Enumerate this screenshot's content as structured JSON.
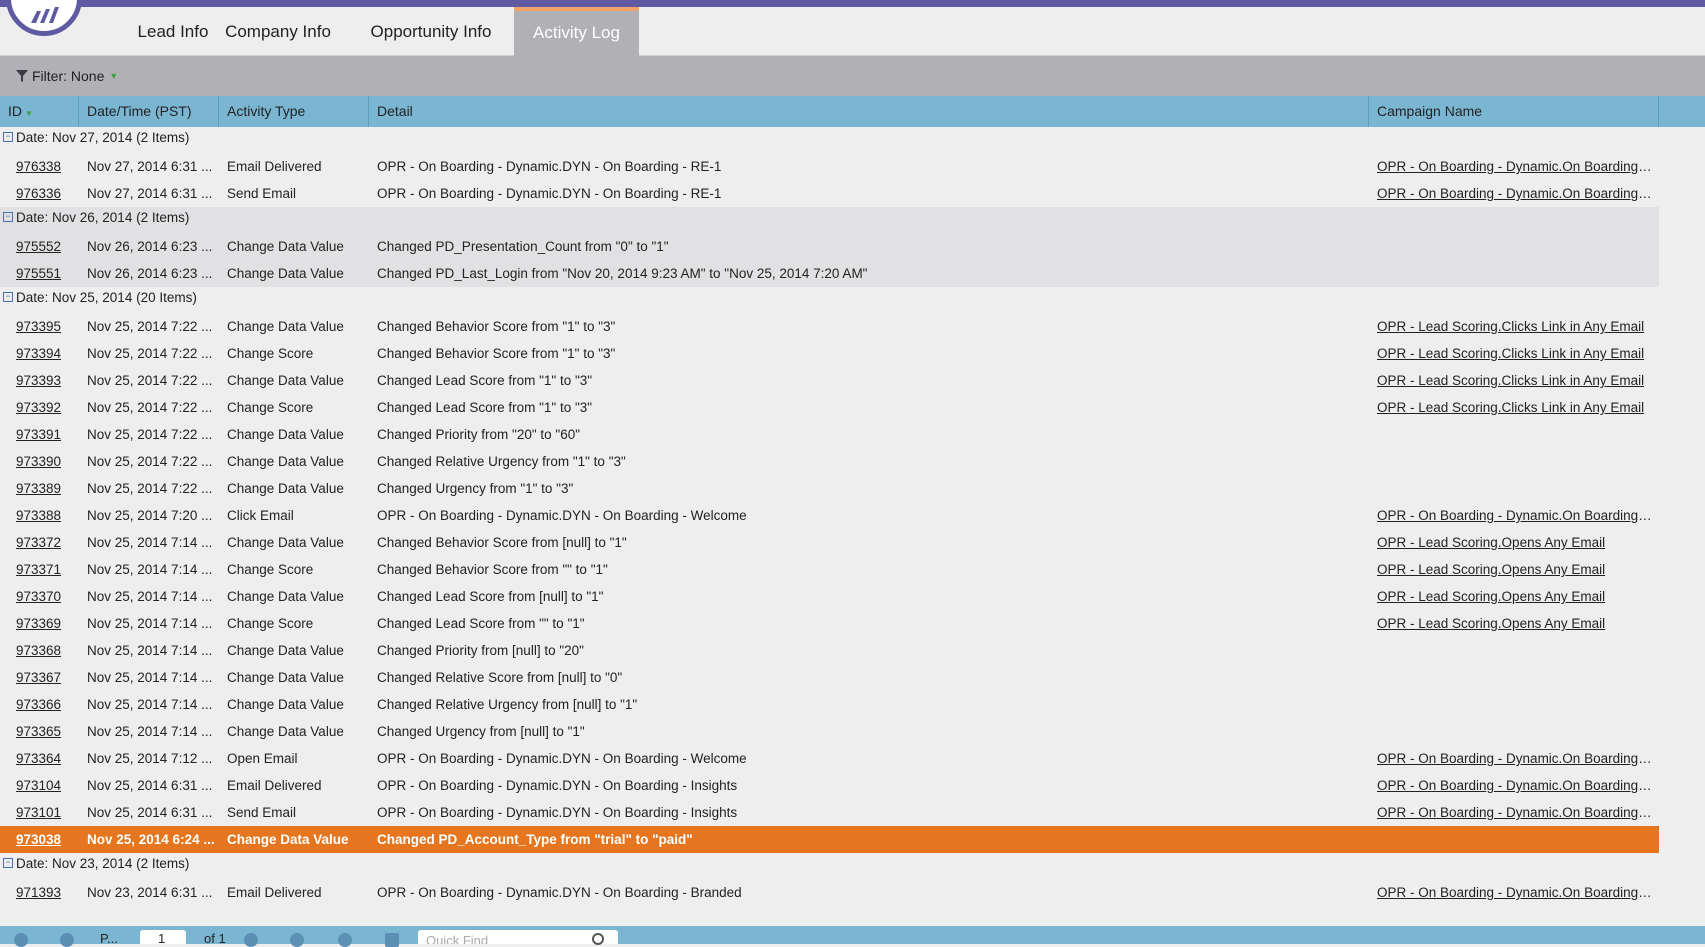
{
  "tabs": [
    "Lead Info",
    "Company Info",
    "Opportunity Info",
    "Activity Log"
  ],
  "active_tab": "Activity Log",
  "filter": {
    "label": "Filter: None"
  },
  "columns": {
    "id": "ID",
    "datetime": "Date/Time (PST)",
    "type": "Activity Type",
    "detail": "Detail",
    "campaign": "Campaign Name"
  },
  "groups": [
    {
      "label": "Date: Nov 27, 2014 (2 Items)",
      "rows": [
        {
          "id": "976338",
          "datetime": "Nov 27, 2014 6:31 ...",
          "type": "Email Delivered",
          "detail": "OPR - On Boarding - Dynamic.DYN - On Boarding - RE-1",
          "campaign": "OPR - On Boarding - Dynamic.On Boarding D..."
        },
        {
          "id": "976336",
          "datetime": "Nov 27, 2014 6:31 ...",
          "type": "Send Email",
          "detail": "OPR - On Boarding - Dynamic.DYN - On Boarding - RE-1",
          "campaign": "OPR - On Boarding - Dynamic.On Boarding D..."
        }
      ]
    },
    {
      "label": "Date: Nov 26, 2014 (2 Items)",
      "rows": [
        {
          "id": "975552",
          "datetime": "Nov 26, 2014 6:23 ...",
          "type": "Change Data Value",
          "detail": "Changed PD_Presentation_Count from \"0\" to \"1\"",
          "campaign": ""
        },
        {
          "id": "975551",
          "datetime": "Nov 26, 2014 6:23 ...",
          "type": "Change Data Value",
          "detail": "Changed PD_Last_Login from \"Nov 20, 2014 9:23 AM\" to \"Nov 25, 2014 7:20 AM\"",
          "campaign": ""
        }
      ]
    },
    {
      "label": "Date: Nov 25, 2014 (20 Items)",
      "rows": [
        {
          "id": "973395",
          "datetime": "Nov 25, 2014 7:22 ...",
          "type": "Change Data Value",
          "detail": "Changed Behavior Score from \"1\" to \"3\"",
          "campaign": "OPR - Lead Scoring.Clicks Link in Any Email"
        },
        {
          "id": "973394",
          "datetime": "Nov 25, 2014 7:22 ...",
          "type": "Change Score",
          "detail": "Changed Behavior Score from \"1\" to \"3\"",
          "campaign": "OPR - Lead Scoring.Clicks Link in Any Email"
        },
        {
          "id": "973393",
          "datetime": "Nov 25, 2014 7:22 ...",
          "type": "Change Data Value",
          "detail": "Changed Lead Score from \"1\" to \"3\"",
          "campaign": "OPR - Lead Scoring.Clicks Link in Any Email"
        },
        {
          "id": "973392",
          "datetime": "Nov 25, 2014 7:22 ...",
          "type": "Change Score",
          "detail": "Changed Lead Score from \"1\" to \"3\"",
          "campaign": "OPR - Lead Scoring.Clicks Link in Any Email"
        },
        {
          "id": "973391",
          "datetime": "Nov 25, 2014 7:22 ...",
          "type": "Change Data Value",
          "detail": "Changed Priority from \"20\" to \"60\"",
          "campaign": ""
        },
        {
          "id": "973390",
          "datetime": "Nov 25, 2014 7:22 ...",
          "type": "Change Data Value",
          "detail": "Changed Relative Urgency from \"1\" to \"3\"",
          "campaign": ""
        },
        {
          "id": "973389",
          "datetime": "Nov 25, 2014 7:22 ...",
          "type": "Change Data Value",
          "detail": "Changed Urgency from \"1\" to \"3\"",
          "campaign": ""
        },
        {
          "id": "973388",
          "datetime": "Nov 25, 2014 7:20 ...",
          "type": "Click Email",
          "detail": "OPR - On Boarding - Dynamic.DYN - On Boarding - Welcome",
          "campaign": "OPR - On Boarding - Dynamic.On Boarding D..."
        },
        {
          "id": "973372",
          "datetime": "Nov 25, 2014 7:14 ...",
          "type": "Change Data Value",
          "detail": "Changed Behavior Score from [null] to \"1\"",
          "campaign": "OPR - Lead Scoring.Opens Any Email"
        },
        {
          "id": "973371",
          "datetime": "Nov 25, 2014 7:14 ...",
          "type": "Change Score",
          "detail": "Changed Behavior Score from \"\" to \"1\"",
          "campaign": "OPR - Lead Scoring.Opens Any Email"
        },
        {
          "id": "973370",
          "datetime": "Nov 25, 2014 7:14 ...",
          "type": "Change Data Value",
          "detail": "Changed Lead Score from [null] to \"1\"",
          "campaign": "OPR - Lead Scoring.Opens Any Email"
        },
        {
          "id": "973369",
          "datetime": "Nov 25, 2014 7:14 ...",
          "type": "Change Score",
          "detail": "Changed Lead Score from \"\" to \"1\"",
          "campaign": "OPR - Lead Scoring.Opens Any Email"
        },
        {
          "id": "973368",
          "datetime": "Nov 25, 2014 7:14 ...",
          "type": "Change Data Value",
          "detail": "Changed Priority from [null] to \"20\"",
          "campaign": ""
        },
        {
          "id": "973367",
          "datetime": "Nov 25, 2014 7:14 ...",
          "type": "Change Data Value",
          "detail": "Changed Relative Score from [null] to \"0\"",
          "campaign": ""
        },
        {
          "id": "973366",
          "datetime": "Nov 25, 2014 7:14 ...",
          "type": "Change Data Value",
          "detail": "Changed Relative Urgency from [null] to \"1\"",
          "campaign": ""
        },
        {
          "id": "973365",
          "datetime": "Nov 25, 2014 7:14 ...",
          "type": "Change Data Value",
          "detail": "Changed Urgency from [null] to \"1\"",
          "campaign": ""
        },
        {
          "id": "973364",
          "datetime": "Nov 25, 2014 7:12 ...",
          "type": "Open Email",
          "detail": "OPR - On Boarding - Dynamic.DYN - On Boarding - Welcome",
          "campaign": "OPR - On Boarding - Dynamic.On Boarding D..."
        },
        {
          "id": "973104",
          "datetime": "Nov 25, 2014 6:31 ...",
          "type": "Email Delivered",
          "detail": "OPR - On Boarding - Dynamic.DYN - On Boarding - Insights",
          "campaign": "OPR - On Boarding - Dynamic.On Boarding D..."
        },
        {
          "id": "973101",
          "datetime": "Nov 25, 2014 6:31 ...",
          "type": "Send Email",
          "detail": "OPR - On Boarding - Dynamic.DYN - On Boarding - Insights",
          "campaign": "OPR - On Boarding - Dynamic.On Boarding D..."
        },
        {
          "id": "973038",
          "datetime": "Nov 25, 2014 6:24 ...",
          "type": "Change Data Value",
          "detail": "Changed PD_Account_Type from \"trial\" to \"paid\"",
          "campaign": "",
          "selected": true
        }
      ]
    },
    {
      "label": "Date: Nov 23, 2014 (2 Items)",
      "rows": [
        {
          "id": "971393",
          "datetime": "Nov 23, 2014 6:31 ...",
          "type": "Email Delivered",
          "detail": "OPR - On Boarding - Dynamic.DYN - On Boarding - Branded",
          "campaign": "OPR - On Boarding - Dynamic.On Boarding D..."
        }
      ]
    }
  ],
  "bottom": {
    "page_label": "P...",
    "page_value": "1",
    "of_label": "of 1",
    "search_placeholder": "Quick Find"
  },
  "colors": {
    "brand": "#5f5aa2",
    "header": "#7ab6d2",
    "selected": "#e5761f",
    "tab_active": "#b0b0b5"
  },
  "icons": [
    "logo-icon",
    "filter-funnel-icon",
    "sort-down-icon",
    "collapse-icon",
    "first-page-icon",
    "prev-page-icon",
    "next-page-icon",
    "last-page-icon",
    "refresh-icon",
    "export-icon",
    "search-icon"
  ]
}
